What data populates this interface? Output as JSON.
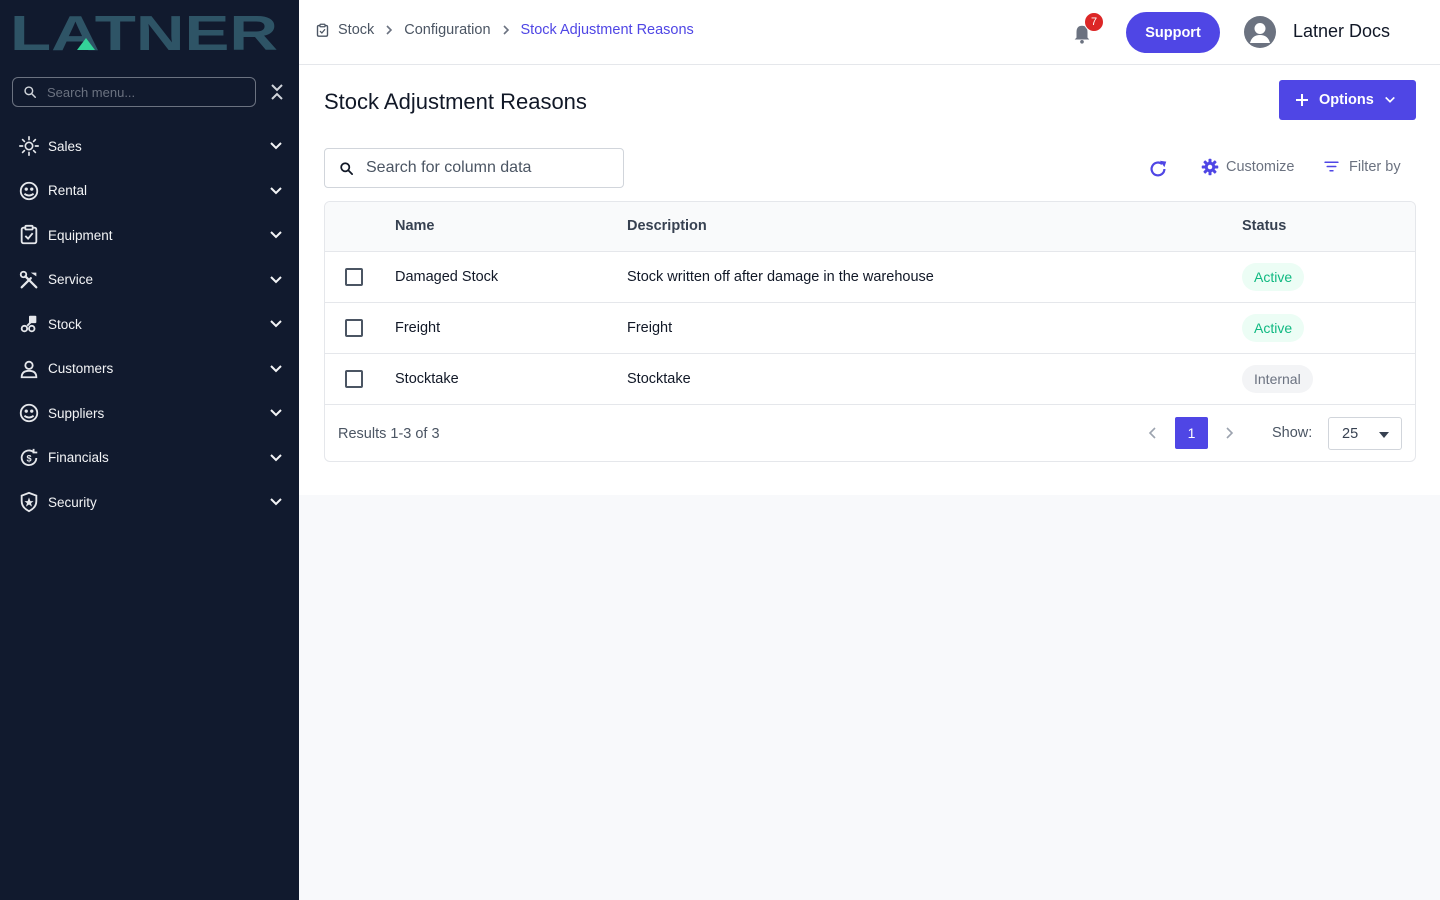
{
  "brand": {
    "logo_text": "LATNER"
  },
  "sidebar": {
    "search_placeholder": "Search menu...",
    "items": [
      {
        "label": "Sales",
        "icon": "sales-icon"
      },
      {
        "label": "Rental",
        "icon": "rental-icon"
      },
      {
        "label": "Equipment",
        "icon": "equipment-icon"
      },
      {
        "label": "Service",
        "icon": "service-icon"
      },
      {
        "label": "Stock",
        "icon": "stock-icon"
      },
      {
        "label": "Customers",
        "icon": "customers-icon"
      },
      {
        "label": "Suppliers",
        "icon": "suppliers-icon"
      },
      {
        "label": "Financials",
        "icon": "financials-icon"
      },
      {
        "label": "Security",
        "icon": "security-icon"
      }
    ]
  },
  "header": {
    "breadcrumbs": [
      "Stock",
      "Configuration",
      "Stock Adjustment Reasons"
    ],
    "notification_count": "7",
    "support_label": "Support",
    "user_name": "Latner Docs"
  },
  "page": {
    "title": "Stock Adjustment Reasons",
    "options_label": "Options",
    "search_placeholder": "Search for column data",
    "customize_label": "Customize",
    "filter_label": "Filter by"
  },
  "table": {
    "columns": [
      "Name",
      "Description",
      "Status"
    ],
    "rows": [
      {
        "name": "Damaged Stock",
        "description": "Stock written off after damage in the warehouse",
        "status": "Active"
      },
      {
        "name": "Freight",
        "description": "Freight",
        "status": "Active"
      },
      {
        "name": "Stocktake",
        "description": "Stocktake",
        "status": "Internal"
      }
    ],
    "results_text": "Results 1-3 of 3",
    "current_page": "1",
    "show_label": "Show:",
    "page_size": "25"
  },
  "colors": {
    "sidebar_bg": "#111a2e",
    "accent": "#4f46e5",
    "active_status": "#10b981",
    "logo": "#2e5466"
  }
}
